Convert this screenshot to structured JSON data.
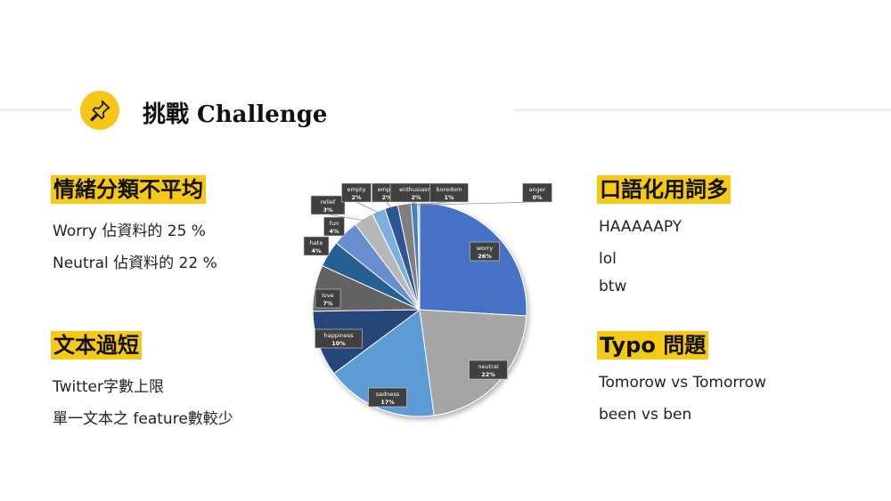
{
  "header": {
    "title": "挑戰 Challenge",
    "icon": "pushpin-icon"
  },
  "left": {
    "section1": {
      "heading": "情緒分類不平均",
      "lines": [
        "Worry 佔資料的 25 %",
        "Neutral 佔資料的 22 %"
      ]
    },
    "section2": {
      "heading": "文本過短",
      "lines": [
        "Twitter字數上限",
        "單一文本之 feature數較少"
      ]
    }
  },
  "right": {
    "section1": {
      "heading": "口語化用詞多",
      "lines": [
        "HAAAAAPY",
        "lol",
        "btw"
      ]
    },
    "section2": {
      "heading": "Typo 問題",
      "lines": [
        "Tomorow vs Tomorrow",
        "been vs ben"
      ]
    }
  },
  "colors": {
    "accent": "#f7c816"
  },
  "chart_data": {
    "type": "pie",
    "slices": [
      {
        "label": "worry",
        "pct_label": "26%",
        "value": 26,
        "color": "#4472c4"
      },
      {
        "label": "neutral",
        "pct_label": "22%",
        "value": 22,
        "color": "#a5a5a5"
      },
      {
        "label": "sadness",
        "pct_label": "17%",
        "value": 17,
        "color": "#5b9bd5"
      },
      {
        "label": "happiness",
        "pct_label": "10%",
        "value": 10,
        "color": "#264478"
      },
      {
        "label": "love",
        "pct_label": "7%",
        "value": 7,
        "color": "#636363"
      },
      {
        "label": "hate",
        "pct_label": "4%",
        "value": 4,
        "color": "#255e91"
      },
      {
        "label": "fun",
        "pct_label": "4%",
        "value": 4,
        "color": "#698ed0"
      },
      {
        "label": "relief",
        "pct_label": "3%",
        "value": 3,
        "color": "#b7b7b7"
      },
      {
        "label": "empty",
        "pct_label": "2%",
        "value": 2,
        "color": "#7cafdd"
      },
      {
        "label": "empty",
        "pct_label": "2%",
        "value": 2,
        "color": "#2f5597"
      },
      {
        "label": "enthusiasm",
        "pct_label": "2%",
        "value": 2,
        "color": "#7f7f7f"
      },
      {
        "label": "boredom",
        "pct_label": "1%",
        "value": 1,
        "color": "#4a7fbf"
      },
      {
        "label": "anger",
        "pct_label": "0%",
        "value": 0.3,
        "color": "#9dc3e6"
      }
    ]
  }
}
